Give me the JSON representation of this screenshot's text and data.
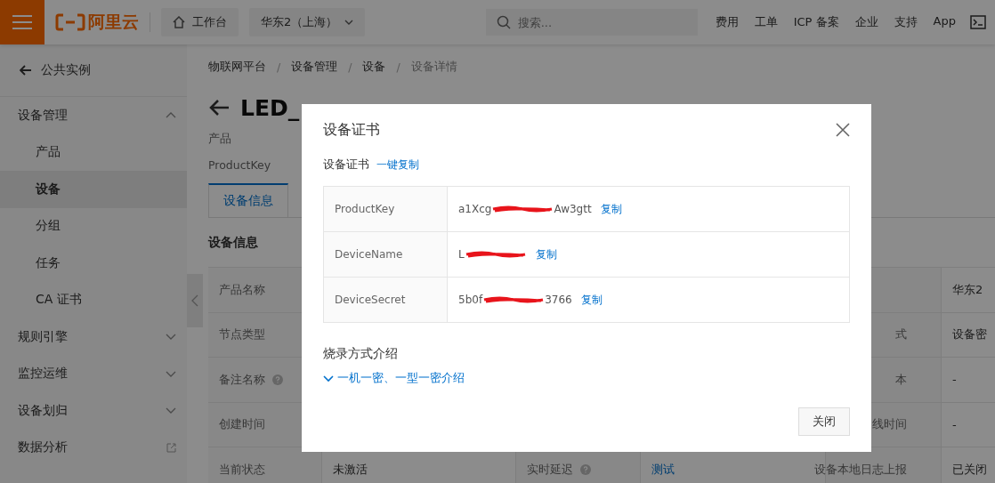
{
  "topbar": {
    "brand": "阿里云",
    "workbench": "工作台",
    "region": "华东2（上海）",
    "search": {
      "placeholder": "搜索..."
    },
    "links": [
      "费用",
      "工单",
      "ICP 备案",
      "企业",
      "支持",
      "App"
    ]
  },
  "sidebar": {
    "back": "公共实例",
    "items": [
      {
        "label": "设备管理",
        "kind": "group",
        "expanded": true,
        "selected": false
      },
      {
        "label": "产品",
        "kind": "sub",
        "selected": false
      },
      {
        "label": "设备",
        "kind": "sub",
        "selected": true
      },
      {
        "label": "分组",
        "kind": "sub",
        "selected": false
      },
      {
        "label": "任务",
        "kind": "sub",
        "selected": false
      },
      {
        "label": "CA 证书",
        "kind": "sub",
        "selected": false
      },
      {
        "label": "规则引擎",
        "kind": "group",
        "expanded": false,
        "selected": false
      },
      {
        "label": "监控运维",
        "kind": "group",
        "expanded": false,
        "selected": false
      },
      {
        "label": "设备划归",
        "kind": "group",
        "expanded": false,
        "selected": false
      },
      {
        "label": "数据分析",
        "kind": "external",
        "selected": false
      }
    ]
  },
  "breadcrumb": {
    "items": [
      "物联网平台",
      "设备管理",
      "设备",
      "设备详情"
    ],
    "separator": "/"
  },
  "device": {
    "title": "LED_",
    "product_label": "产品",
    "productkey_label": "ProductKey"
  },
  "tabs": [
    {
      "label": "设备信息",
      "selected": true
    }
  ],
  "section_title": "设备信息",
  "table": {
    "rows": [
      {
        "column_1": "产品名称",
        "column_6": "华东2"
      },
      {
        "column_1": "节点类型",
        "column_5": "式",
        "column_6": "设备密"
      },
      {
        "column_1": "备注名称",
        "column_1_help": true,
        "column_5": "本",
        "column_6": "-"
      },
      {
        "column_1": "创建时间",
        "column_5": "线时间",
        "column_6": "-"
      },
      {
        "column_1": "当前状态",
        "column_2": "未激活",
        "column_3": "实时延迟",
        "column_3_help": true,
        "column_4": "测试",
        "column_5": "设备本地日志上报",
        "column_6": "已关闭"
      }
    ]
  },
  "dialog": {
    "title": "设备证书",
    "subtitle": "设备证书",
    "copy_all": "一键复制",
    "rows": [
      {
        "key": "ProductKey",
        "value_start": "a1Xcg",
        "value_end": "Aw3gtt",
        "copy": "复制"
      },
      {
        "key": "DeviceName",
        "value_start": "L",
        "value_end": "",
        "copy": "复制"
      },
      {
        "key": "DeviceSecret",
        "value_start": "5b0f",
        "value_end": "3766",
        "copy": "复制"
      }
    ],
    "section": "烧录方式介绍",
    "intro_link": "一机一密、一型一密介绍",
    "intro_expanded": false,
    "close_button": "关闭"
  }
}
